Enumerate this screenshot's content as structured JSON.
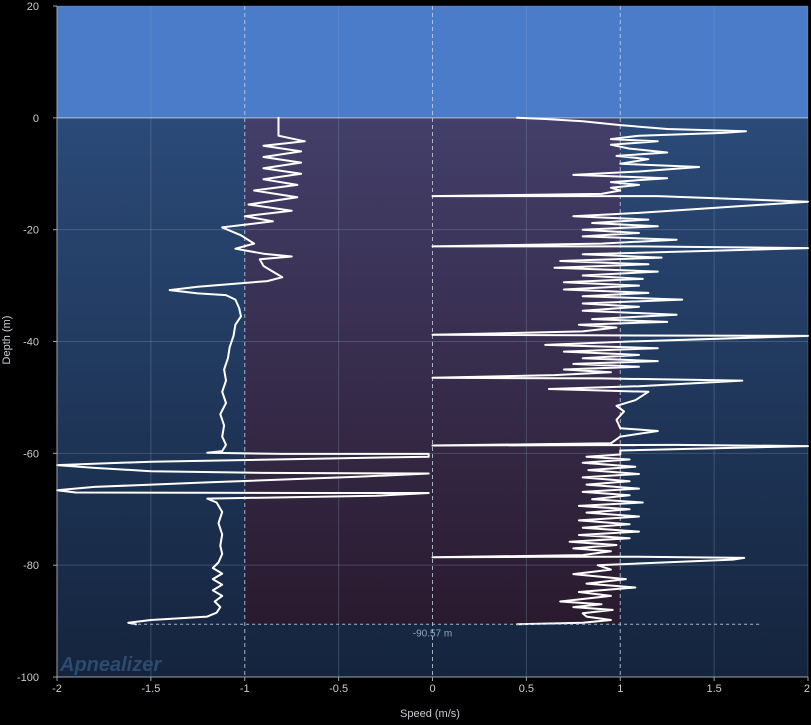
{
  "watermark": "Apnealizer",
  "chart_data": {
    "type": "line",
    "title": "",
    "xlabel": "Speed (m/s)",
    "ylabel": "Depth (m)",
    "xlim": [
      -2,
      2
    ],
    "ylim": [
      -100,
      20
    ],
    "x_ticks": [
      -2,
      -1.5,
      -1,
      -0.5,
      0,
      0.5,
      1,
      1.5,
      2
    ],
    "x_tick_labels": [
      "-2",
      "-1.5",
      "-1",
      "-0.5",
      "0",
      "0.5",
      "1",
      "1.5",
      "2"
    ],
    "y_ticks": [
      20,
      0,
      -20,
      -40,
      -60,
      -80,
      -100
    ],
    "y_tick_labels": [
      "20",
      "0",
      "-20",
      "-40",
      "-60",
      "-80",
      "-100"
    ],
    "grid": true,
    "surface_depth": 0,
    "max_depth": -90.57,
    "max_depth_label": "-90.57 m",
    "speed_band": [
      -1,
      1
    ],
    "colors": {
      "sky": "#4a7cc9",
      "water_top": "#2b4a78",
      "water_bottom": "#14243d",
      "band_top": "#433f6a",
      "band_bottom": "#2a1a2e",
      "line": "#ffffff",
      "grid": "#8fa3bd"
    },
    "series": [
      {
        "segment": "descent",
        "points": [
          [
            -0.82,
            0
          ],
          [
            -0.82,
            -2
          ],
          [
            -0.82,
            -3.2
          ],
          [
            -0.68,
            -4.2
          ],
          [
            -0.9,
            -5.0
          ],
          [
            -0.7,
            -6.0
          ],
          [
            -0.9,
            -7.0
          ],
          [
            -0.7,
            -8.0
          ],
          [
            -0.9,
            -9.0
          ],
          [
            -0.7,
            -10.0
          ],
          [
            -0.9,
            -11.0
          ],
          [
            -0.72,
            -12.0
          ],
          [
            -0.95,
            -13.0
          ],
          [
            -0.72,
            -14.2
          ],
          [
            -0.98,
            -15.5
          ],
          [
            -0.75,
            -16.6
          ],
          [
            -1.0,
            -17.6
          ],
          [
            -0.85,
            -18.5
          ],
          [
            -1.12,
            -19.6
          ],
          [
            -1.02,
            -21.0
          ],
          [
            -0.95,
            -22.5
          ],
          [
            -1.05,
            -23.4
          ],
          [
            -0.9,
            -24.3
          ],
          [
            -0.75,
            -24.8
          ],
          [
            -0.92,
            -25.3
          ],
          [
            -0.9,
            -26.5
          ],
          [
            -0.85,
            -27.5
          ],
          [
            -0.8,
            -28.5
          ],
          [
            -0.88,
            -29.2
          ],
          [
            -1.25,
            -30.2
          ],
          [
            -1.4,
            -30.8
          ],
          [
            -1.25,
            -31.4
          ],
          [
            -1.1,
            -31.7
          ],
          [
            -1.05,
            -32.5
          ],
          [
            -1.03,
            -34.0
          ],
          [
            -1.02,
            -35.5
          ],
          [
            -1.05,
            -37.0
          ],
          [
            -1.06,
            -39.0
          ],
          [
            -1.08,
            -41.0
          ],
          [
            -1.09,
            -43.0
          ],
          [
            -1.11,
            -45.0
          ],
          [
            -1.1,
            -47.0
          ],
          [
            -1.12,
            -49.0
          ],
          [
            -1.1,
            -51.0
          ],
          [
            -1.13,
            -53.0
          ],
          [
            -1.11,
            -55.0
          ],
          [
            -1.12,
            -57.0
          ],
          [
            -1.1,
            -58.5
          ],
          [
            -1.12,
            -59.6
          ],
          [
            -1.2,
            -59.9
          ],
          [
            -0.8,
            -60.1
          ],
          [
            -0.02,
            -60.1
          ],
          [
            -0.02,
            -60.6
          ],
          [
            -1.5,
            -61.5
          ],
          [
            -2.0,
            -62.1
          ],
          [
            -1.8,
            -62.6
          ],
          [
            -1.5,
            -63.2
          ],
          [
            -0.9,
            -63.5
          ],
          [
            -0.02,
            -63.6
          ],
          [
            -0.4,
            -64.2
          ],
          [
            -1.2,
            -65.2
          ],
          [
            -1.8,
            -66.0
          ],
          [
            -2.0,
            -66.6
          ],
          [
            -1.9,
            -67.0
          ],
          [
            -0.6,
            -67.1
          ],
          [
            -0.02,
            -67.1
          ],
          [
            -0.3,
            -67.6
          ],
          [
            -1.2,
            -68.1
          ],
          [
            -1.15,
            -68.8
          ],
          [
            -1.12,
            -70.5
          ],
          [
            -1.14,
            -72.5
          ],
          [
            -1.12,
            -74.5
          ],
          [
            -1.13,
            -76.5
          ],
          [
            -1.12,
            -78.0
          ],
          [
            -1.14,
            -79.5
          ],
          [
            -1.17,
            -80.5
          ],
          [
            -1.12,
            -81.5
          ],
          [
            -1.17,
            -82.5
          ],
          [
            -1.12,
            -83.5
          ],
          [
            -1.17,
            -84.5
          ],
          [
            -1.12,
            -85.5
          ],
          [
            -1.16,
            -86.5
          ],
          [
            -1.13,
            -87.5
          ],
          [
            -1.15,
            -88.5
          ],
          [
            -1.2,
            -89.2
          ],
          [
            -1.5,
            -89.8
          ],
          [
            -1.62,
            -90.3
          ],
          [
            -1.58,
            -90.57
          ]
        ]
      },
      {
        "segment": "ascent",
        "points": [
          [
            0.45,
            -90.57
          ],
          [
            0.8,
            -90.3
          ],
          [
            0.95,
            -89.8
          ],
          [
            0.82,
            -89.2
          ],
          [
            0.8,
            -88.6
          ],
          [
            0.96,
            -88.0
          ],
          [
            0.75,
            -87.5
          ],
          [
            0.9,
            -87.0
          ],
          [
            0.68,
            -86.5
          ],
          [
            0.95,
            -85.5
          ],
          [
            0.78,
            -84.8
          ],
          [
            1.08,
            -84.0
          ],
          [
            0.82,
            -83.3
          ],
          [
            1.03,
            -82.5
          ],
          [
            0.75,
            -81.6
          ],
          [
            0.95,
            -80.8
          ],
          [
            0.88,
            -80.0
          ],
          [
            1.6,
            -79.0
          ],
          [
            1.66,
            -78.7
          ],
          [
            1.1,
            -78.5
          ],
          [
            0.6,
            -78.5
          ],
          [
            0.0,
            -78.6
          ],
          [
            0.8,
            -78.2
          ],
          [
            0.95,
            -77.5
          ],
          [
            0.75,
            -77.0
          ],
          [
            0.98,
            -76.4
          ],
          [
            0.73,
            -75.8
          ],
          [
            1.05,
            -75.2
          ],
          [
            0.78,
            -74.6
          ],
          [
            1.1,
            -74.0
          ],
          [
            0.8,
            -73.3
          ],
          [
            1.05,
            -72.7
          ],
          [
            0.78,
            -72.0
          ],
          [
            1.1,
            -71.3
          ],
          [
            0.82,
            -70.6
          ],
          [
            1.05,
            -70.0
          ],
          [
            0.78,
            -69.4
          ],
          [
            1.12,
            -68.8
          ],
          [
            0.85,
            -68.2
          ],
          [
            1.05,
            -67.5
          ],
          [
            0.8,
            -66.9
          ],
          [
            1.1,
            -66.3
          ],
          [
            0.82,
            -65.6
          ],
          [
            1.05,
            -65.0
          ],
          [
            0.8,
            -64.3
          ],
          [
            1.1,
            -63.7
          ],
          [
            0.83,
            -63.0
          ],
          [
            1.08,
            -62.4
          ],
          [
            0.8,
            -61.7
          ],
          [
            1.05,
            -61.1
          ],
          [
            0.82,
            -60.6
          ],
          [
            1.0,
            -60.2
          ],
          [
            1.0,
            -59.5
          ],
          [
            2.0,
            -58.7
          ],
          [
            1.3,
            -58.5
          ],
          [
            0.0,
            -58.6
          ],
          [
            0.95,
            -58.2
          ],
          [
            1.0,
            -57.0
          ],
          [
            1.2,
            -56.0
          ],
          [
            1.0,
            -55.5
          ],
          [
            0.98,
            -54.0
          ],
          [
            1.02,
            -52.5
          ],
          [
            0.98,
            -51.5
          ],
          [
            1.08,
            -50.5
          ],
          [
            1.15,
            -49.0
          ],
          [
            0.62,
            -48.5
          ],
          [
            1.1,
            -48.0
          ],
          [
            1.65,
            -47.0
          ],
          [
            0.9,
            -46.6
          ],
          [
            0.0,
            -46.5
          ],
          [
            0.65,
            -46.0
          ],
          [
            0.95,
            -45.5
          ],
          [
            0.7,
            -45.0
          ],
          [
            1.1,
            -44.5
          ],
          [
            0.75,
            -44.0
          ],
          [
            1.2,
            -43.5
          ],
          [
            0.8,
            -43.0
          ],
          [
            1.1,
            -42.4
          ],
          [
            0.7,
            -41.8
          ],
          [
            1.2,
            -41.2
          ],
          [
            0.6,
            -40.6
          ],
          [
            1.05,
            -40.0
          ],
          [
            2.0,
            -39.0
          ],
          [
            0.8,
            -38.9
          ],
          [
            0.0,
            -38.8
          ],
          [
            0.8,
            -38.2
          ],
          [
            0.98,
            -37.5
          ],
          [
            0.78,
            -37.0
          ],
          [
            1.25,
            -36.5
          ],
          [
            0.85,
            -36.0
          ],
          [
            1.3,
            -35.2
          ],
          [
            0.8,
            -34.5
          ],
          [
            1.1,
            -33.8
          ],
          [
            0.8,
            -33.2
          ],
          [
            1.33,
            -32.5
          ],
          [
            0.8,
            -31.9
          ],
          [
            1.15,
            -31.3
          ],
          [
            0.7,
            -30.7
          ],
          [
            1.1,
            -30.0
          ],
          [
            0.7,
            -29.4
          ],
          [
            1.12,
            -28.8
          ],
          [
            0.8,
            -28.2
          ],
          [
            1.2,
            -27.5
          ],
          [
            0.65,
            -26.8
          ],
          [
            1.15,
            -26.2
          ],
          [
            0.68,
            -25.6
          ],
          [
            1.22,
            -25.0
          ],
          [
            0.8,
            -24.4
          ],
          [
            2.0,
            -23.3
          ],
          [
            1.1,
            -23.0
          ],
          [
            0.0,
            -23.0
          ],
          [
            0.9,
            -22.5
          ],
          [
            1.3,
            -21.8
          ],
          [
            0.8,
            -21.2
          ],
          [
            1.1,
            -20.6
          ],
          [
            0.8,
            -20.0
          ],
          [
            1.2,
            -19.4
          ],
          [
            0.85,
            -18.8
          ],
          [
            1.15,
            -18.2
          ],
          [
            0.75,
            -17.6
          ],
          [
            1.1,
            -17.0
          ],
          [
            2.0,
            -15.0
          ],
          [
            1.2,
            -14.0
          ],
          [
            0.0,
            -14.0
          ],
          [
            0.9,
            -13.6
          ],
          [
            1.0,
            -13.0
          ],
          [
            0.95,
            -12.5
          ],
          [
            1.1,
            -12.0
          ],
          [
            0.95,
            -11.5
          ],
          [
            1.25,
            -10.8
          ],
          [
            0.75,
            -10.2
          ],
          [
            1.1,
            -9.6
          ],
          [
            1.42,
            -8.8
          ],
          [
            1.0,
            -8.2
          ],
          [
            1.15,
            -7.4
          ],
          [
            0.98,
            -6.8
          ],
          [
            1.25,
            -6.2
          ],
          [
            1.05,
            -5.5
          ],
          [
            0.95,
            -4.8
          ],
          [
            1.2,
            -4.2
          ],
          [
            0.95,
            -3.8
          ],
          [
            1.1,
            -3.2
          ],
          [
            1.55,
            -2.7
          ],
          [
            1.67,
            -2.4
          ],
          [
            1.25,
            -2.0
          ],
          [
            1.0,
            -1.3
          ],
          [
            0.8,
            -0.6
          ],
          [
            0.6,
            -0.2
          ],
          [
            0.45,
            0
          ]
        ]
      }
    ]
  }
}
